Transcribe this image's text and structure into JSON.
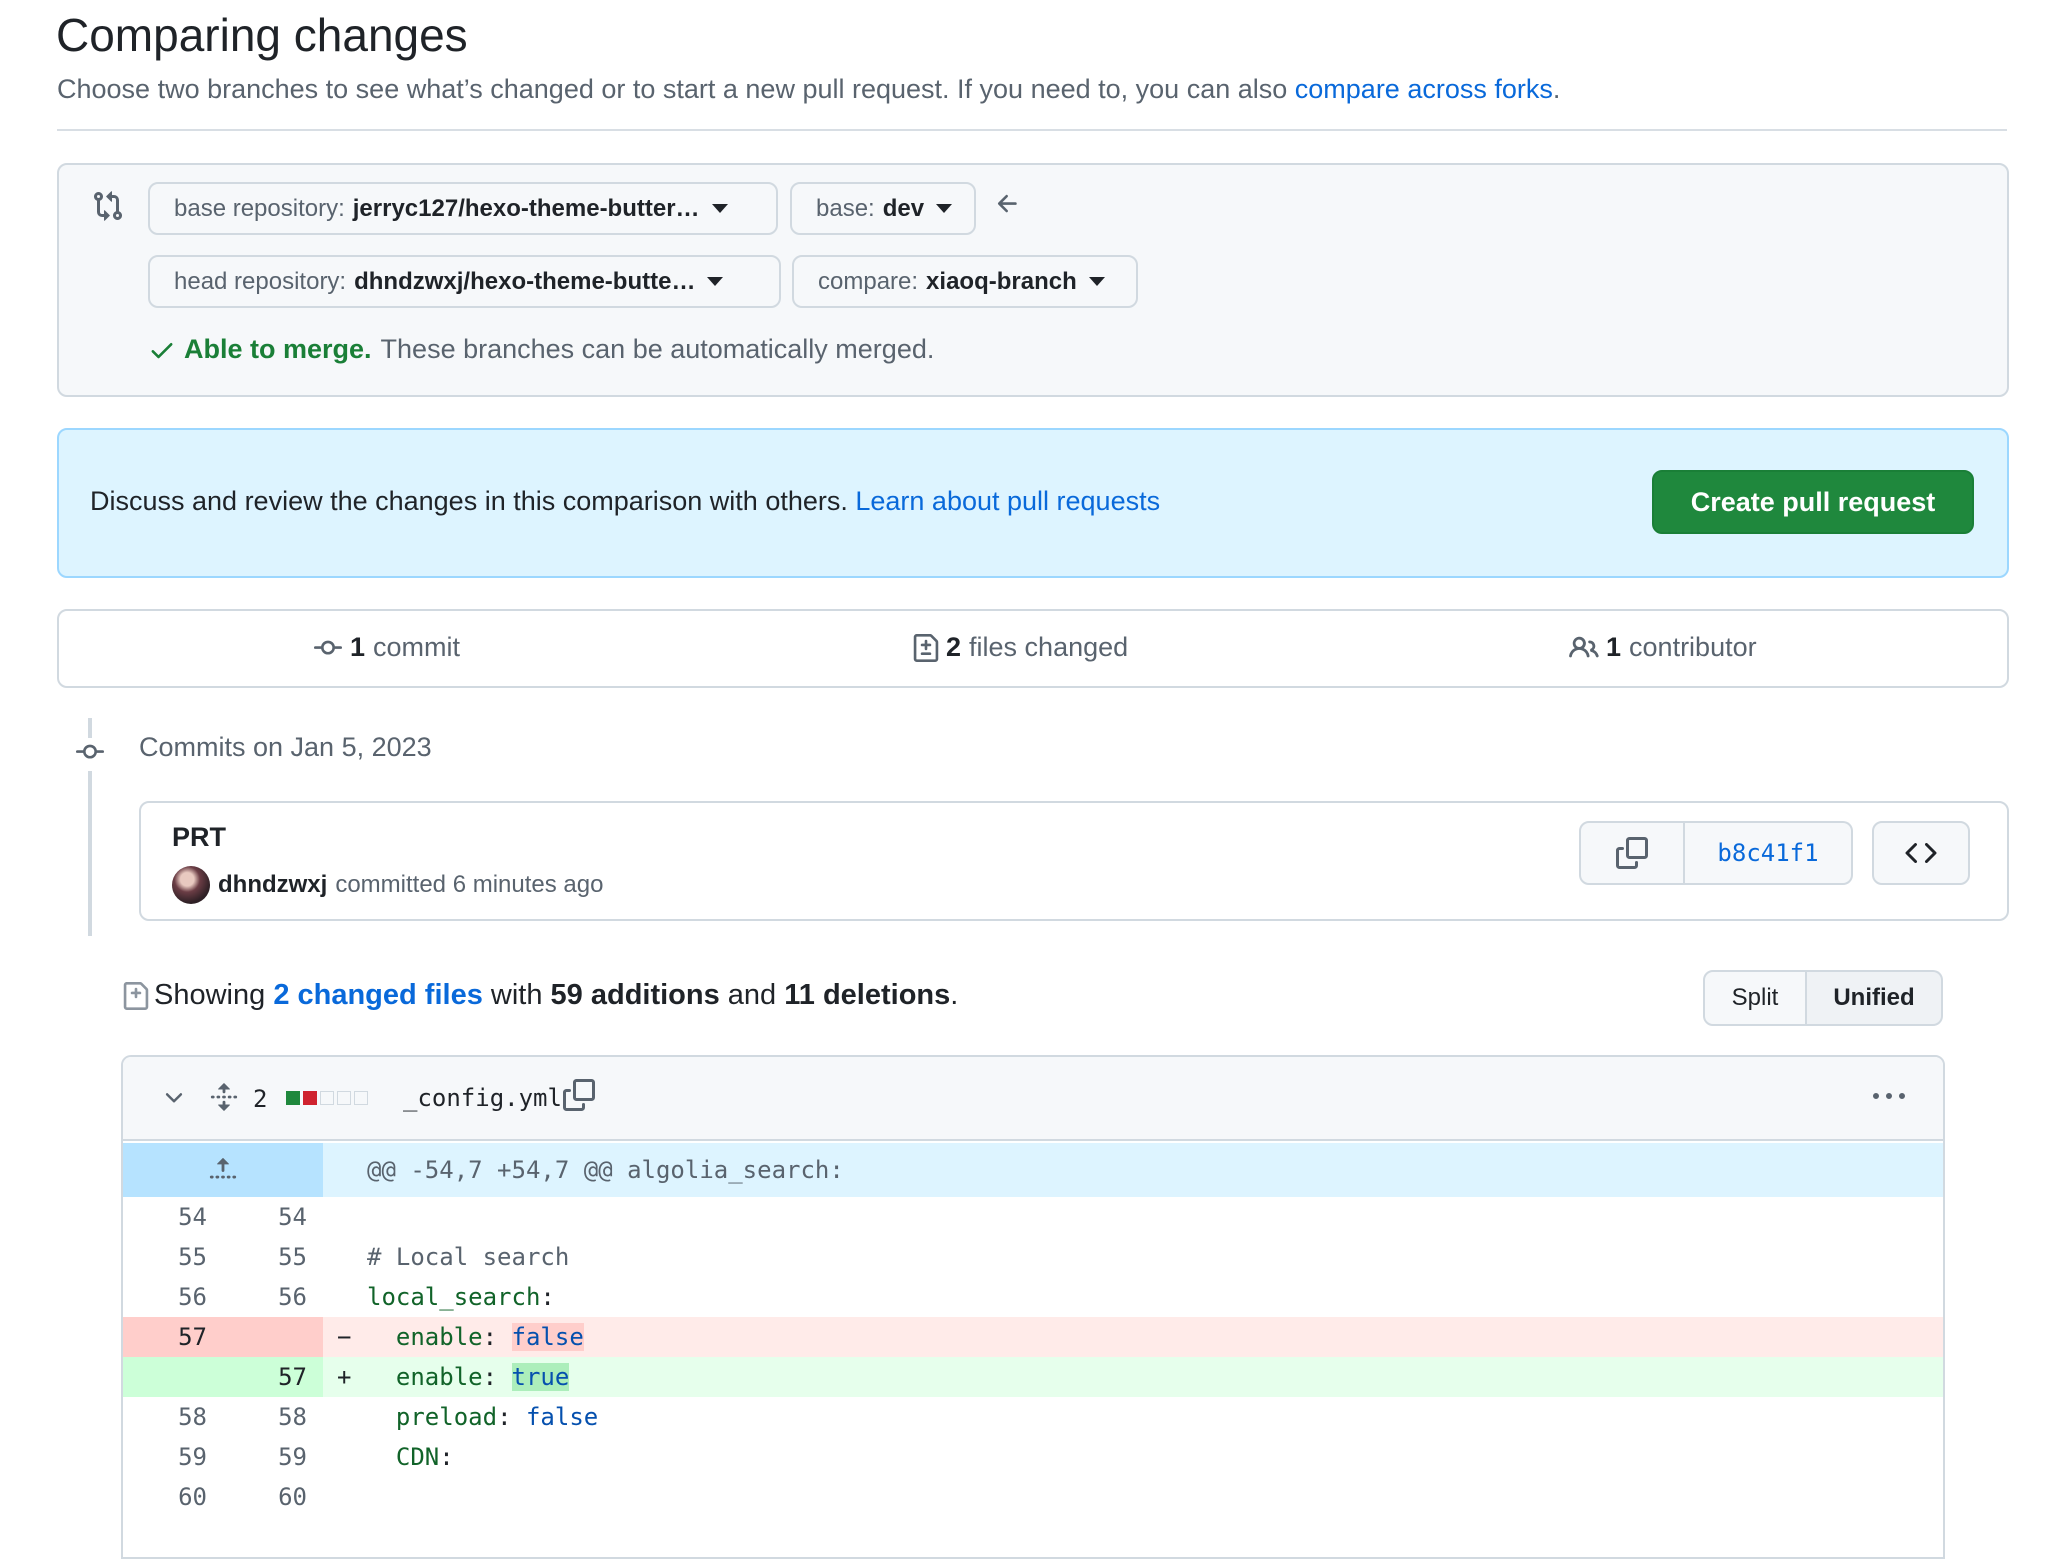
{
  "header": {
    "title": "Comparing changes",
    "subtitle": "Choose two branches to see what’s changed or to start a new pull request. If you need to, you can also",
    "subtitle_link": "compare across forks",
    "subtitle_end": "."
  },
  "range": {
    "base_repo_label": "base repository:",
    "base_repo_value": "jerryc127/hexo-theme-butter…",
    "base_label": "base:",
    "base_value": "dev",
    "head_repo_label": "head repository:",
    "head_repo_value": "dhndzwxj/hexo-theme-butte…",
    "compare_label": "compare:",
    "compare_value": "xiaoq-branch",
    "merge_ok": "Able to merge.",
    "merge_text": "These branches can be automatically merged."
  },
  "flash": {
    "text": "Discuss and review the changes in this comparison with others.",
    "link": "Learn about pull requests",
    "button": "Create pull request"
  },
  "summary": {
    "commits_count": "1",
    "commits_label": "commit",
    "files_count": "2",
    "files_label": "files changed",
    "contributors_count": "1",
    "contributors_label": "contributor"
  },
  "commits": {
    "date": "Commits on Jan 5, 2023",
    "title": "PRT",
    "author": "dhndzwxj",
    "meta": "committed 6 minutes ago",
    "sha": "b8c41f1"
  },
  "diff_toolbar": {
    "showing": "Showing",
    "changed_files": "2 changed files",
    "with": "with",
    "additions": "59 additions",
    "and": "and",
    "deletions": "11 deletions",
    "end": ".",
    "split": "Split",
    "unified": "Unified"
  },
  "file": {
    "changes": "2",
    "name": "_config.yml",
    "hunk": "@@ -54,7 +54,7 @@ algolia_search:",
    "lines": [
      {
        "old": "54",
        "new": "54",
        "type": "ctx",
        "sign": "",
        "text": ""
      },
      {
        "old": "55",
        "new": "55",
        "type": "ctx",
        "sign": "",
        "text": "# Local search"
      },
      {
        "old": "56",
        "new": "56",
        "type": "ctx",
        "sign": "",
        "text": "local_search:"
      },
      {
        "old": "57",
        "new": "",
        "type": "del",
        "sign": "−",
        "text": "  enable: false"
      },
      {
        "old": "",
        "new": "57",
        "type": "add",
        "sign": "+",
        "text": "  enable: true"
      },
      {
        "old": "58",
        "new": "58",
        "type": "ctx",
        "sign": "",
        "text": "  preload: false"
      },
      {
        "old": "59",
        "new": "59",
        "type": "ctx",
        "sign": "",
        "text": "  CDN:"
      },
      {
        "old": "60",
        "new": "60",
        "type": "ctx",
        "sign": "",
        "text": ""
      }
    ]
  },
  "colors": {
    "accent": "#0969da",
    "success": "#1f883d",
    "del_bg": "#ffebe9",
    "del_num_bg": "#ffcecb",
    "add_bg": "#e6ffec",
    "add_num_bg": "#ccffd8",
    "hunk_bg": "#ddf4ff"
  }
}
